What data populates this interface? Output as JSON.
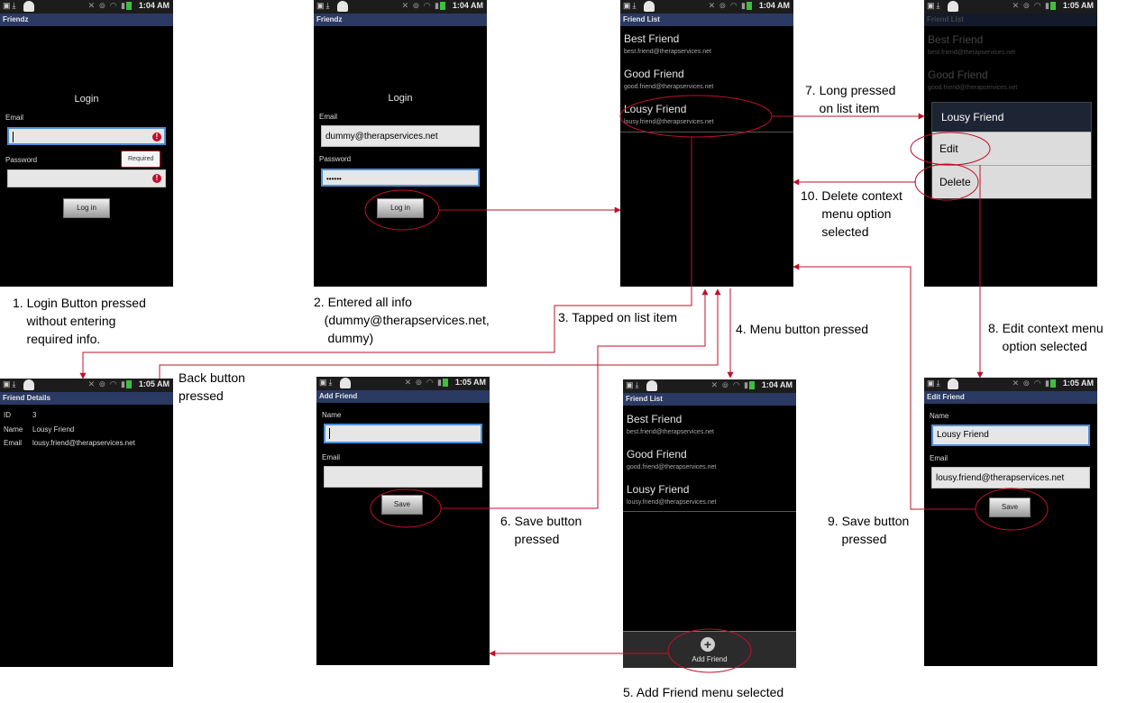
{
  "status": {
    "t1": "1:04 AM",
    "t2": "1:05 AM"
  },
  "login": {
    "title": "Friendz",
    "heading": "Login",
    "email_label": "Email",
    "password_label": "Password",
    "button": "Log in",
    "tooltip": "Required",
    "email_value": "dummy@therapservices.net",
    "password_value": "••••••"
  },
  "friend_list": {
    "title": "Friend List",
    "items": [
      {
        "name": "Best Friend",
        "email": "best.friend@therapservices.net"
      },
      {
        "name": "Good Friend",
        "email": "good.friend@therapservices.net"
      },
      {
        "name": "Lousy Friend",
        "email": "lousy.friend@therapservices.net"
      }
    ]
  },
  "context_menu": {
    "header": "Lousy Friend",
    "edit": "Edit",
    "delete": "Delete"
  },
  "friend_details": {
    "title": "Friend Details",
    "rows": [
      {
        "k": "ID",
        "v": "3"
      },
      {
        "k": "Name",
        "v": "Lousy Friend"
      },
      {
        "k": "Email",
        "v": "lousy.friend@therapservices.net"
      }
    ]
  },
  "add_friend": {
    "title": "Add Friend",
    "name_label": "Name",
    "email_label": "Email",
    "save": "Save",
    "menu_item": "Add Friend"
  },
  "edit_friend": {
    "title": "Edit Friend",
    "name_label": "Name",
    "email_label": "Email",
    "name_value": "Lousy Friend",
    "email_value": "lousy.friend@therapservices.net",
    "save": "Save"
  },
  "captions": {
    "c1": "1. Login Button pressed\n    without entering\n    required info.",
    "c2": "2. Entered all info\n   (dummy@therapservices.net,\n    dummy)",
    "c3": "3. Tapped on list item",
    "c4": "4. Menu button pressed",
    "c5": "5. Add Friend menu selected",
    "c6": "6. Save button\n    pressed",
    "c7": "7. Long pressed\n    on list item",
    "c8": "8. Edit context menu\n    option selected",
    "c9": "9. Save button\n    pressed",
    "c10": "10. Delete context\n      menu option\n      selected",
    "back": "Back button\npressed"
  }
}
